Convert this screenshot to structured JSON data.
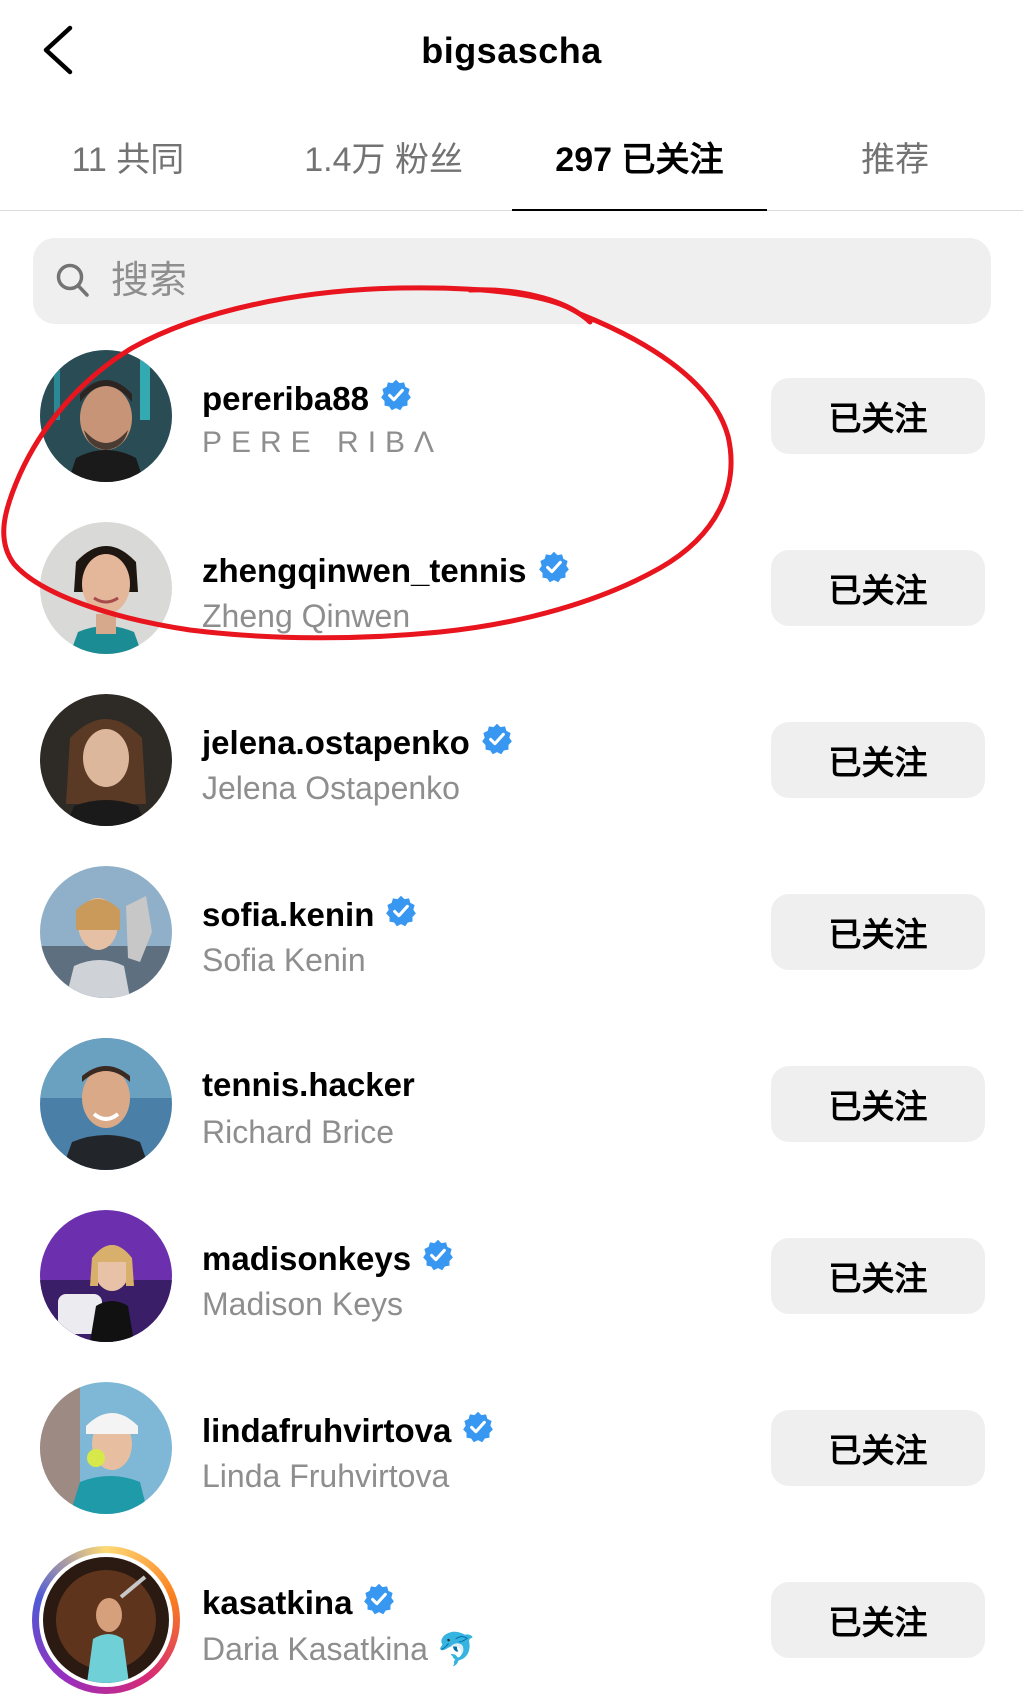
{
  "header": {
    "title": "bigsascha"
  },
  "tabs": [
    {
      "label": "11 共同"
    },
    {
      "label": "1.4万 粉丝"
    },
    {
      "label": "297 已关注"
    },
    {
      "label": "推荐"
    }
  ],
  "search": {
    "placeholder": "搜索"
  },
  "users": [
    {
      "username": "pereriba88",
      "full_name": "PERE RIBΛ",
      "verified": true,
      "button": "已关注"
    },
    {
      "username": "zhengqinwen_tennis",
      "full_name": "Zheng Qinwen",
      "verified": true,
      "button": "已关注"
    },
    {
      "username": "jelena.ostapenko",
      "full_name": "Jelena Ostapenko",
      "verified": true,
      "button": "已关注"
    },
    {
      "username": "sofia.kenin",
      "full_name": "Sofia Kenin",
      "verified": true,
      "button": "已关注"
    },
    {
      "username": "tennis.hacker",
      "full_name": "Richard Brice",
      "verified": false,
      "button": "已关注"
    },
    {
      "username": "madisonkeys",
      "full_name": "Madison Keys",
      "verified": true,
      "button": "已关注"
    },
    {
      "username": "lindafruhvirtova",
      "full_name": "Linda Fruhvirtova",
      "verified": true,
      "button": "已关注"
    },
    {
      "username": "kasatkina",
      "full_name": "Daria Kasatkina 🐬",
      "verified": true,
      "button": "已关注"
    }
  ],
  "colors": {
    "verified": "#3897f0",
    "annotation": "#e8141e",
    "button_bg": "#efefef"
  }
}
